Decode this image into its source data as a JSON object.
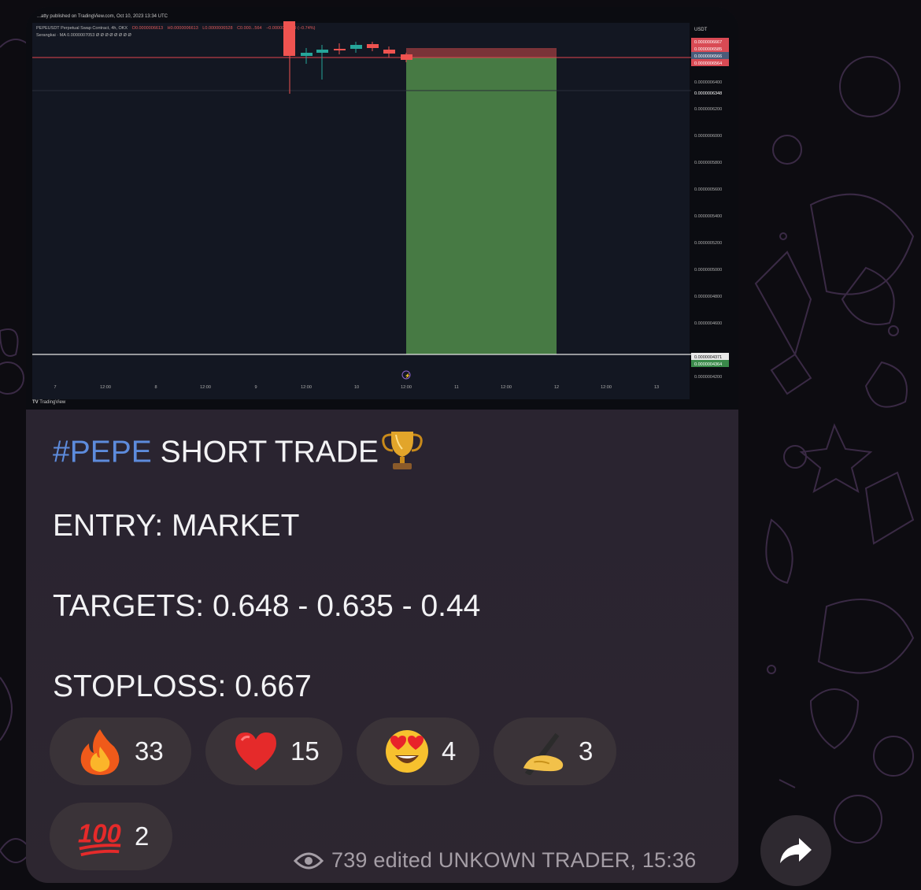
{
  "chart": {
    "header_publish": "...atty published on TradingView.com, Oct 10, 2023 13:34 UTC",
    "symbol_line_prefix": "PEPEUSDT Perpetual Swap Contract, 4h, OKX",
    "ohlc": {
      "open": "O0.0000006613",
      "high": "H0.0000006613",
      "low": "L0.0000006528",
      "close": "C0.000...564",
      "change": "−0.0000000049 (−0.74%)"
    },
    "ma_line": "Serangkai · MA 0.0000007053 Ø Ø Ø Ø Ø Ø Ø Ø",
    "currency_label": "USDT",
    "price_tags": [
      {
        "label": "0.0000006667",
        "color": "#d94a54"
      },
      {
        "label": "0.0000006585",
        "color": "#d94a54"
      },
      {
        "label": "0.0000006566",
        "color": "#4a5c7a"
      },
      {
        "label": "0.0000006564",
        "color": "#d94a54"
      },
      {
        "label": "0.0000006348",
        "color": "#0b0c11"
      },
      {
        "label": "0.0000004371",
        "color": "#e8e8e8"
      },
      {
        "label": "0.0000004364",
        "color": "#3a8a4a"
      }
    ],
    "y_ticks": [
      "0.0000006400",
      "0.0000006200",
      "0.0000006000",
      "0.0000005800",
      "0.0000005600",
      "0.0000005400",
      "0.0000005200",
      "0.0000005000",
      "0.0000004800",
      "0.0000004600",
      "0.0000004200"
    ],
    "x_ticks": [
      "7",
      "12:00",
      "8",
      "12:00",
      "9",
      "12:00",
      "10",
      "12:00",
      "11",
      "12:00",
      "12",
      "12:00",
      "13"
    ],
    "watermark": "TradingView",
    "colors": {
      "up": "#26a69a",
      "down": "#ef5350",
      "profit_zone": "#477a44",
      "loss_zone": "#7a3338",
      "accent_line": "#e0444e"
    }
  },
  "message": {
    "hashtag": "#PEPE",
    "title_rest": " SHORT TRADE",
    "entry": "ENTRY: MARKET",
    "targets": "TARGETS: 0.648 - 0.635 - 0.44",
    "stoploss": "STOPLOSS: 0.667"
  },
  "reactions": [
    {
      "emoji": "fire-icon",
      "count": "33"
    },
    {
      "emoji": "heart-icon",
      "count": "15"
    },
    {
      "emoji": "heart-eyes-icon",
      "count": "4"
    },
    {
      "emoji": "writing-hand-icon",
      "count": "3"
    },
    {
      "emoji": "hundred-points-icon",
      "count": "2"
    }
  ],
  "meta": {
    "views": "739",
    "edited": "edited",
    "author": "UNKOWN TRADER,",
    "time": "15:36"
  }
}
